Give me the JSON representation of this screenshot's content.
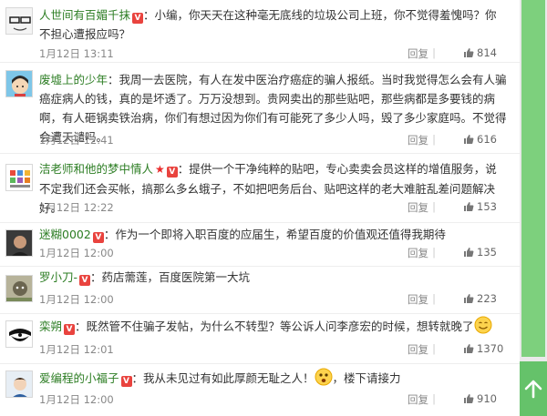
{
  "comments": [
    {
      "username": "人世间有百媚千抹",
      "text": "：小编，你天天在这种毫无底线的垃圾公司上班，你不觉得羞愧吗？你不担心遭报应吗？",
      "time": "1月12日 13:11",
      "reply_label": "回复",
      "likes": "814"
    },
    {
      "username": "废墟上的少年",
      "text": "：我周一去医院，有人在发中医治疗癌症的骗人报纸。当时我觉得怎么会有人骗癌症病人的钱，真的是坏透了。万万没想到。贵网卖出的那些贴吧，那些病都是多要钱的病啊，有人砸锅卖铁治病，你们有想过因为你们有可能死了多少人吗，毁了多少家庭吗。不觉得会遭天谴吗。",
      "time": "1月12日 12:41",
      "reply_label": "回复",
      "likes": "616"
    },
    {
      "username": "洁老师和他的梦中情人",
      "text": "：提供一个干净纯粹的贴吧，专心卖卖会员这样的增值服务，说不定我们还会买帐，搞那么多幺蛾子，不如把吧务后台、贴吧这样的老大难脏乱差问题解决好。",
      "time": "1月12日 12:22",
      "reply_label": "回复",
      "likes": "153"
    },
    {
      "username": "迷糊0002",
      "text": "：作为一个即将入职百度的应届生，希望百度的价值观还值得我期待",
      "time": "1月12日 12:00",
      "reply_label": "回复",
      "likes": "135"
    },
    {
      "username": "罗小刀-",
      "text": "：药店薷莲，百度医院第一大坑",
      "time": "1月12日 12:00",
      "reply_label": "回复",
      "likes": "223"
    },
    {
      "username": "栾朔",
      "text": "：既然管不住骗子发帖，为什么不转型？等公诉人问李彦宏的时候，想转就晚了",
      "time": "1月12日 12:01",
      "reply_label": "回复",
      "likes": "1370"
    },
    {
      "username": "爱编程的小福子",
      "text_before": "：我从未见过有如此厚颜无耻之人！",
      "text_after": "，楼下请接力",
      "time": "1月12日 12:00",
      "reply_label": "回复",
      "likes": "910"
    }
  ],
  "icons": {
    "badge": "vip-badge-icon",
    "like": "thumbs-up-icon",
    "star": "star-icon",
    "smile": "smile-emoji-icon",
    "scroll_top": "arrow-up-icon"
  },
  "colors": {
    "username": "#2c7d23",
    "badge": "#e9433e",
    "scrollbar": "#7dd07d"
  }
}
